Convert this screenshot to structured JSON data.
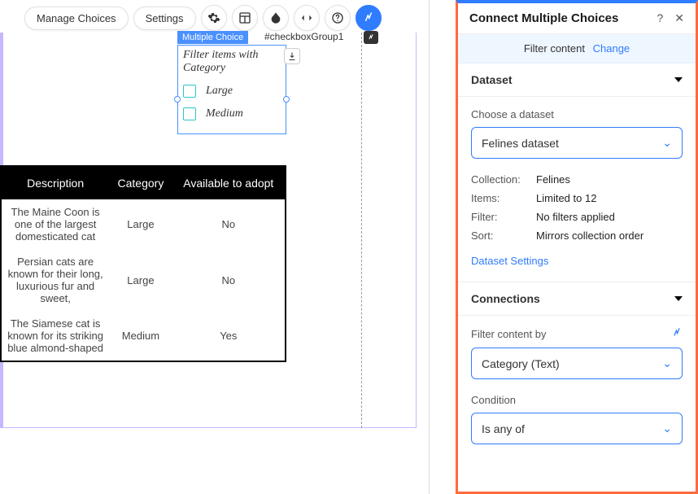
{
  "toolbar": {
    "manage_choices": "Manage Choices",
    "settings": "Settings"
  },
  "checkbox_group": {
    "title": "Filter items with Category",
    "badge": "Multiple Choice",
    "id": "#checkboxGroup1",
    "options": [
      "Large",
      "Medium"
    ]
  },
  "table": {
    "headers": [
      "Description",
      "Category",
      "Available to adopt"
    ],
    "rows": [
      {
        "desc": "The Maine Coon is one of the largest domesticated cat",
        "category": "Large",
        "available": "No"
      },
      {
        "desc": "Persian cats are known for their long, luxurious fur and sweet,",
        "category": "Large",
        "available": "No"
      },
      {
        "desc": "The Siamese cat is known for its striking blue almond-shaped",
        "category": "Medium",
        "available": "Yes"
      }
    ]
  },
  "panel": {
    "title": "Connect Multiple Choices",
    "filter_bar_label": "Filter content",
    "filter_bar_action": "Change",
    "dataset_section": "Dataset",
    "choose_dataset_label": "Choose a dataset",
    "dataset_selected": "Felines dataset",
    "meta": {
      "collection_label": "Collection:",
      "collection_value": "Felines",
      "items_label": "Items:",
      "items_value": "Limited to 12",
      "filter_label": "Filter:",
      "filter_value": "No filters applied",
      "sort_label": "Sort:",
      "sort_value": "Mirrors collection order"
    },
    "dataset_settings": "Dataset Settings",
    "connections_section": "Connections",
    "filter_content_by_label": "Filter content by",
    "filter_content_by_value": "Category (Text)",
    "condition_label": "Condition",
    "condition_value": "Is any of"
  }
}
